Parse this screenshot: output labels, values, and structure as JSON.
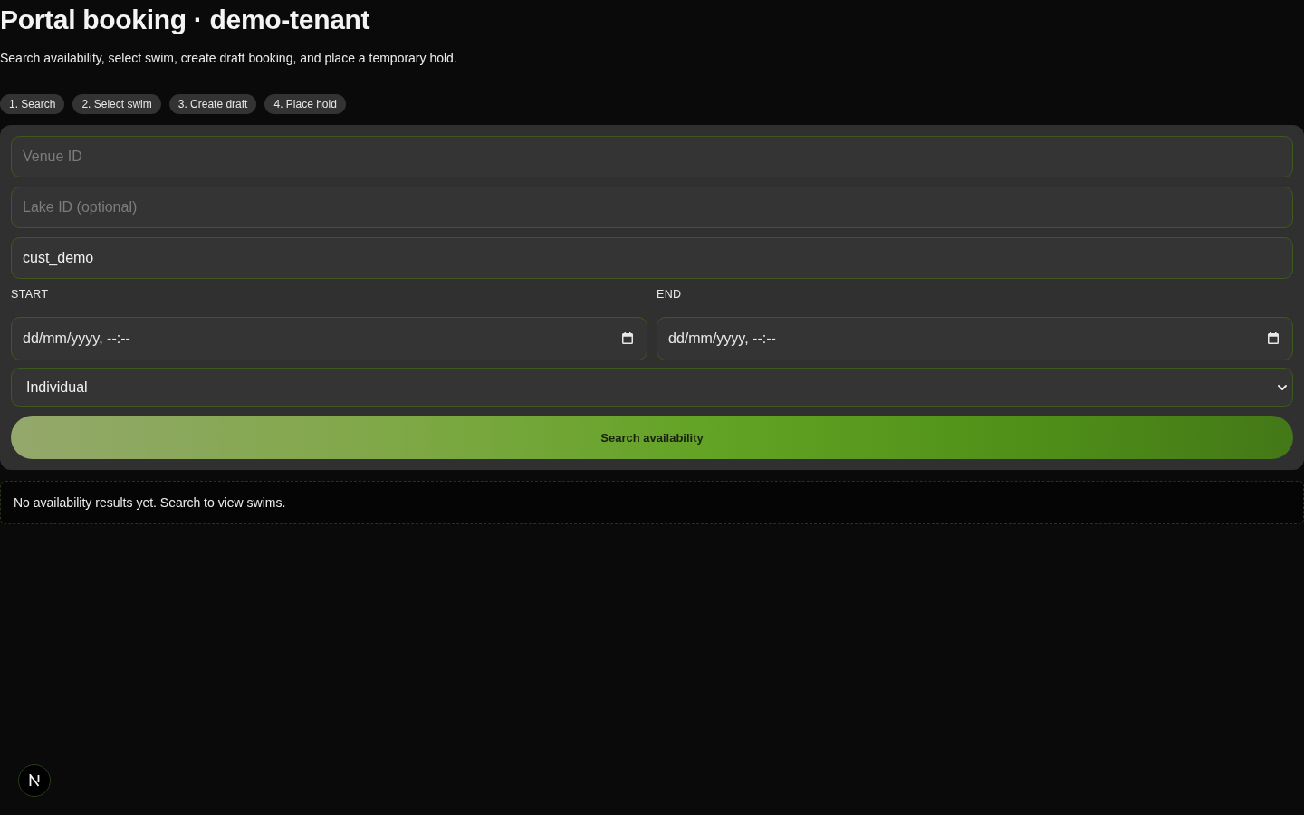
{
  "header": {
    "title": "Portal booking · demo-tenant",
    "subtitle": "Search availability, select swim, create draft booking, and place a temporary hold."
  },
  "steps": [
    "1. Search",
    "2. Select swim",
    "3. Create draft",
    "4. Place hold"
  ],
  "form": {
    "fields": [
      {
        "placeholder": "Venue ID"
      },
      {
        "placeholder": "Lake ID (optional)"
      },
      {
        "value": "cust_demo"
      }
    ],
    "date_fields": [
      {
        "label": "START",
        "placeholder": "dd/mm/yyyy, --:--"
      },
      {
        "label": "END",
        "placeholder": "dd/mm/yyyy, --:--"
      }
    ],
    "booking_type": {
      "value": "Individual"
    },
    "submit_button": "Search availability"
  },
  "results": {
    "empty_message": "No availability results yet. Search to view swims."
  }
}
